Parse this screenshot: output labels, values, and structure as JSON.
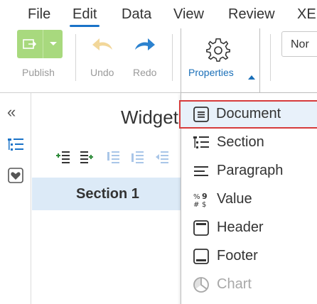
{
  "menu": {
    "items": [
      {
        "label": "File"
      },
      {
        "label": "Edit"
      },
      {
        "label": "Data"
      },
      {
        "label": "View"
      },
      {
        "label": "Review"
      },
      {
        "label": "XE"
      }
    ],
    "active": "Edit"
  },
  "toolbar": {
    "publish_label": "Publish",
    "undo_label": "Undo",
    "redo_label": "Redo",
    "properties_label": "Properties",
    "font_value": "Nor"
  },
  "main": {
    "widget_title": "Widget",
    "section_label": "Section 1"
  },
  "dropdown": {
    "items": [
      {
        "label": "Document",
        "icon": "document-icon",
        "selected": true
      },
      {
        "label": "Section",
        "icon": "section-icon"
      },
      {
        "label": "Paragraph",
        "icon": "paragraph-icon"
      },
      {
        "label": "Value",
        "icon": "value-icon"
      },
      {
        "label": "Header",
        "icon": "header-icon"
      },
      {
        "label": "Footer",
        "icon": "footer-icon"
      },
      {
        "label": "Chart",
        "icon": "chart-icon",
        "disabled": true
      }
    ]
  },
  "colors": {
    "accent": "#1a73c8",
    "publish_green": "#a8d97e",
    "undo_arrow": "#f2d79a",
    "redo_arrow": "#2c82cf",
    "selection_border": "#d63b3b",
    "selection_bg": "#e8f1fa",
    "section_bg": "#dceaf7"
  }
}
